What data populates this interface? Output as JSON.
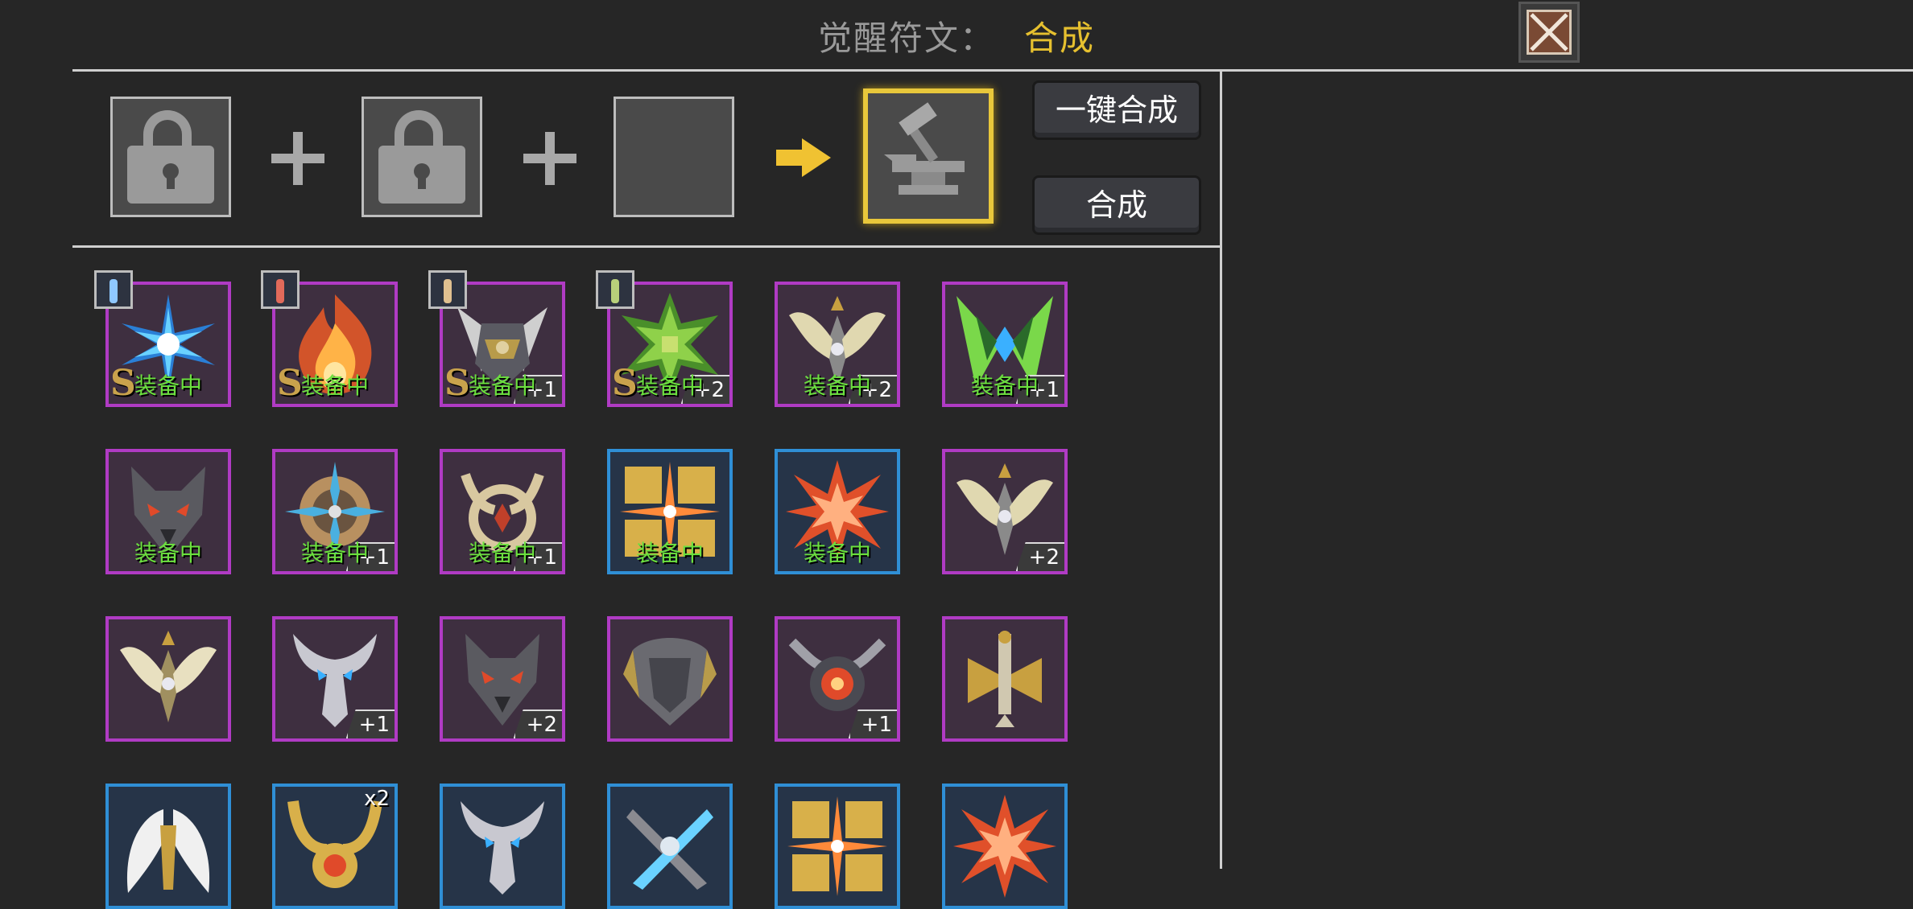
{
  "header": {
    "label": "觉醒符文：",
    "mode": "合成"
  },
  "close_icon": "close-icon",
  "buttons": {
    "one_click": "一键合成",
    "synthesize": "合成"
  },
  "colors": {
    "accent": "#e6c02f",
    "equipped": "#6be03e",
    "purple_frame": "#b03bc4",
    "blue_frame": "#2f8fd6"
  },
  "runes": [
    {
      "frame": "purple",
      "equipped": "装备中",
      "grade": "S",
      "level": "",
      "stack": "",
      "hero": true,
      "hero_color": "#8fc8ff",
      "art": "ice-star",
      "c1": "#6ad2ff",
      "c2": "#2a7fd6"
    },
    {
      "frame": "purple",
      "equipped": "装备中",
      "grade": "S",
      "level": "",
      "stack": "",
      "hero": true,
      "hero_color": "#e06a5a",
      "art": "flame",
      "c1": "#ffb347",
      "c2": "#d2542a"
    },
    {
      "frame": "purple",
      "equipped": "装备中",
      "grade": "S",
      "level": "+1",
      "stack": "",
      "hero": true,
      "hero_color": "#e0c090",
      "art": "winged-helm",
      "c1": "#cfcfcf",
      "c2": "#b89b4a"
    },
    {
      "frame": "purple",
      "equipped": "装备中",
      "grade": "S",
      "level": "+2",
      "stack": "",
      "hero": true,
      "hero_color": "#b8d07a",
      "art": "green-crest",
      "c1": "#8fd14a",
      "c2": "#4a8f2a"
    },
    {
      "frame": "purple",
      "equipped": "装备中",
      "grade": "",
      "level": "+2",
      "stack": "",
      "hero": false,
      "art": "gold-wings",
      "c1": "#e0d8b0",
      "c2": "#8a8a8a"
    },
    {
      "frame": "purple",
      "equipped": "装备中",
      "grade": "",
      "level": "+1",
      "stack": "",
      "hero": false,
      "art": "emerald-claws",
      "c1": "#7ad84a",
      "c2": "#3ab0ff"
    },
    {
      "frame": "purple",
      "equipped": "装备中",
      "grade": "",
      "level": "",
      "stack": "",
      "hero": false,
      "art": "wolf",
      "c1": "#5a5a60",
      "c2": "#e04a2a"
    },
    {
      "frame": "purple",
      "equipped": "装备中",
      "grade": "",
      "level": "+1",
      "stack": "",
      "hero": false,
      "art": "sun-gear",
      "c1": "#b89060",
      "c2": "#4ab0e0"
    },
    {
      "frame": "purple",
      "equipped": "装备中",
      "grade": "",
      "level": "+1",
      "stack": "",
      "hero": false,
      "art": "horned-ring",
      "c1": "#d8c8a0",
      "c2": "#c0402a"
    },
    {
      "frame": "blue",
      "equipped": "装备中",
      "grade": "",
      "level": "",
      "stack": "",
      "hero": false,
      "art": "gold-cross",
      "c1": "#d8b04a",
      "c2": "#ff8a3a"
    },
    {
      "frame": "blue",
      "equipped": "装备中",
      "grade": "",
      "level": "",
      "stack": "",
      "hero": false,
      "art": "red-burst",
      "c1": "#e0502a",
      "c2": "#ffb080"
    },
    {
      "frame": "purple",
      "equipped": "",
      "grade": "",
      "level": "+2",
      "stack": "",
      "hero": false,
      "art": "gold-wings",
      "c1": "#e0d8b0",
      "c2": "#8a8a8a"
    },
    {
      "frame": "purple",
      "equipped": "",
      "grade": "",
      "level": "",
      "stack": "",
      "hero": false,
      "art": "gold-wings",
      "c1": "#e8e0c0",
      "c2": "#a09060"
    },
    {
      "frame": "purple",
      "equipped": "",
      "grade": "",
      "level": "+1",
      "stack": "",
      "hero": false,
      "art": "silver-horns",
      "c1": "#c8c8d0",
      "c2": "#3ab0ff"
    },
    {
      "frame": "purple",
      "equipped": "",
      "grade": "",
      "level": "+2",
      "stack": "",
      "hero": false,
      "art": "wolf",
      "c1": "#5a5a60",
      "c2": "#e04a2a"
    },
    {
      "frame": "purple",
      "equipped": "",
      "grade": "",
      "level": "",
      "stack": "",
      "hero": false,
      "art": "dark-shield",
      "c1": "#6a6a70",
      "c2": "#b89b4a"
    },
    {
      "frame": "purple",
      "equipped": "",
      "grade": "",
      "level": "+1",
      "stack": "",
      "hero": false,
      "art": "horned-orb",
      "c1": "#a0a0a8",
      "c2": "#e04a2a"
    },
    {
      "frame": "purple",
      "equipped": "",
      "grade": "",
      "level": "",
      "stack": "",
      "hero": false,
      "art": "sword-emblem",
      "c1": "#d0c8b0",
      "c2": "#c8a040"
    },
    {
      "frame": "blue",
      "equipped": "",
      "grade": "",
      "level": "",
      "stack": "",
      "hero": false,
      "art": "white-wings",
      "c1": "#f0f0f0",
      "c2": "#c8a040"
    },
    {
      "frame": "blue",
      "equipped": "",
      "grade": "",
      "level": "",
      "stack": "x2",
      "hero": false,
      "art": "gold-horns",
      "c1": "#d8b04a",
      "c2": "#e04a2a"
    },
    {
      "frame": "blue",
      "equipped": "",
      "grade": "",
      "level": "",
      "stack": "",
      "hero": false,
      "art": "silver-horns",
      "c1": "#c8c8d0",
      "c2": "#3ab0ff"
    },
    {
      "frame": "blue",
      "equipped": "",
      "grade": "",
      "level": "",
      "stack": "",
      "hero": false,
      "art": "blade-cross",
      "c1": "#8a8a90",
      "c2": "#6ad2ff"
    },
    {
      "frame": "blue",
      "equipped": "",
      "grade": "",
      "level": "",
      "stack": "",
      "hero": false,
      "art": "gold-cross",
      "c1": "#d8b04a",
      "c2": "#ff8a3a"
    },
    {
      "frame": "blue",
      "equipped": "",
      "grade": "",
      "level": "",
      "stack": "",
      "hero": false,
      "art": "red-burst",
      "c1": "#e0502a",
      "c2": "#ffb080"
    }
  ]
}
